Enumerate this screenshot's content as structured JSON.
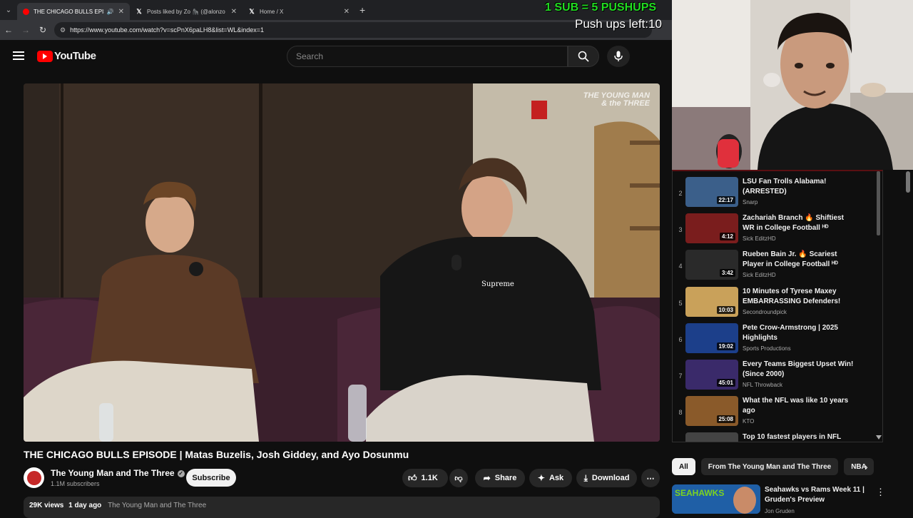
{
  "browser": {
    "tabs": [
      {
        "title": "THE CHICAGO BULLS EPISC",
        "icon": "youtube-icon",
        "active": true,
        "audio": true
      },
      {
        "title": "Posts liked by Zo 🦍 (@alonzo",
        "icon": "x-icon",
        "active": false
      },
      {
        "title": "Home / X",
        "icon": "x-icon",
        "active": false
      }
    ],
    "new_tab": "+",
    "url": "https://www.youtube.com/watch?v=scPnX6paLH8&list=WL&index=1"
  },
  "overlay": {
    "sub_text": "1 SUB = 5 PUSHUPS",
    "pushups_text": "Push ups left:10"
  },
  "youtube": {
    "logo_text": "YouTube",
    "search_placeholder": "Search"
  },
  "video": {
    "watermark_line1": "THE YOUNG MAN",
    "watermark_line2": "& the THREE",
    "shirt_text": "Supreme",
    "title": "THE CHICAGO BULLS EPISODE | Matas Buzelis, Josh Giddey, and Ayo Dosunmu",
    "channel": "The Young Man and The Three",
    "subscribers": "1.1M subscribers",
    "subscribe_label": "Subscribe",
    "likes": "1.1K",
    "share_label": "Share",
    "ask_label": "Ask",
    "download_label": "Download",
    "views": "29K views",
    "age": "1 day ago",
    "desc_channel": "The Young Man and The Three"
  },
  "playlist": {
    "items": [
      {
        "num": "2",
        "title": "LSU Fan Trolls Alabama! (ARRESTED)",
        "channel": "Snarp",
        "duration": "22:17",
        "color": "#3b5f8a"
      },
      {
        "num": "3",
        "title": "Zachariah Branch 🔥 Shiftiest WR in College Football ᴴᴰ",
        "channel": "Sick EditzHD",
        "duration": "4:12",
        "color": "#7a1d1d"
      },
      {
        "num": "4",
        "title": "Rueben Bain Jr. 🔥 Scariest Player in College Football ᴴᴰ",
        "channel": "Sick EditzHD",
        "duration": "3:42",
        "color": "#2a2a2a"
      },
      {
        "num": "5",
        "title": "10 Minutes of Tyrese Maxey EMBARRASSING Defenders!",
        "channel": "Secondroundpick",
        "duration": "10:03",
        "color": "#c9a15a"
      },
      {
        "num": "6",
        "title": "Pete Crow-Armstrong | 2025 Highlights",
        "channel": "Sports Productions",
        "duration": "19:02",
        "color": "#1c3f8a"
      },
      {
        "num": "7",
        "title": "Every Teams Biggest Upset Win! (Since 2000)",
        "channel": "NFL Throwback",
        "duration": "45:01",
        "color": "#3a2a6a"
      },
      {
        "num": "8",
        "title": "What the NFL was like 10 years ago",
        "channel": "KTO",
        "duration": "25:08",
        "color": "#8a5a2a"
      },
      {
        "num": "9",
        "title": "Top 10 fastest players in NFL",
        "channel": "",
        "duration": "",
        "color": "#444444"
      }
    ]
  },
  "chips": [
    "All",
    "From The Young Man and The Three",
    "NBA"
  ],
  "recommend": {
    "title": "Seahawks vs Rams Week 11 | Gruden's Preview",
    "channel": "Jon Gruden",
    "thumb_text": "SEAHAWKS"
  }
}
